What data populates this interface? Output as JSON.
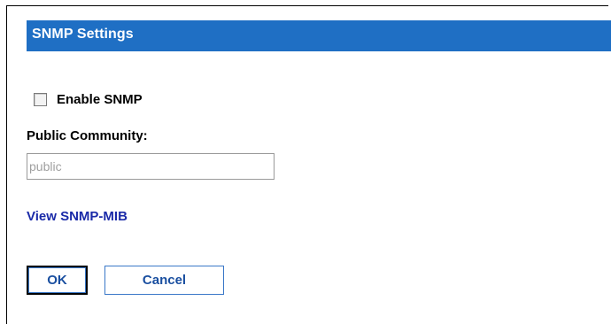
{
  "header": {
    "title": "SNMP Settings"
  },
  "enable_snmp": {
    "label": "Enable SNMP",
    "checked": false
  },
  "public_community": {
    "label": "Public Community:",
    "value": "public"
  },
  "mib_link": {
    "label": "View SNMP-MIB"
  },
  "buttons": {
    "ok_label": "OK",
    "cancel_label": "Cancel"
  },
  "colors": {
    "header_bg": "#1f6fc4",
    "link": "#1a2aa8",
    "button_text": "#1a4fa0",
    "button_border": "#3a78c8"
  }
}
